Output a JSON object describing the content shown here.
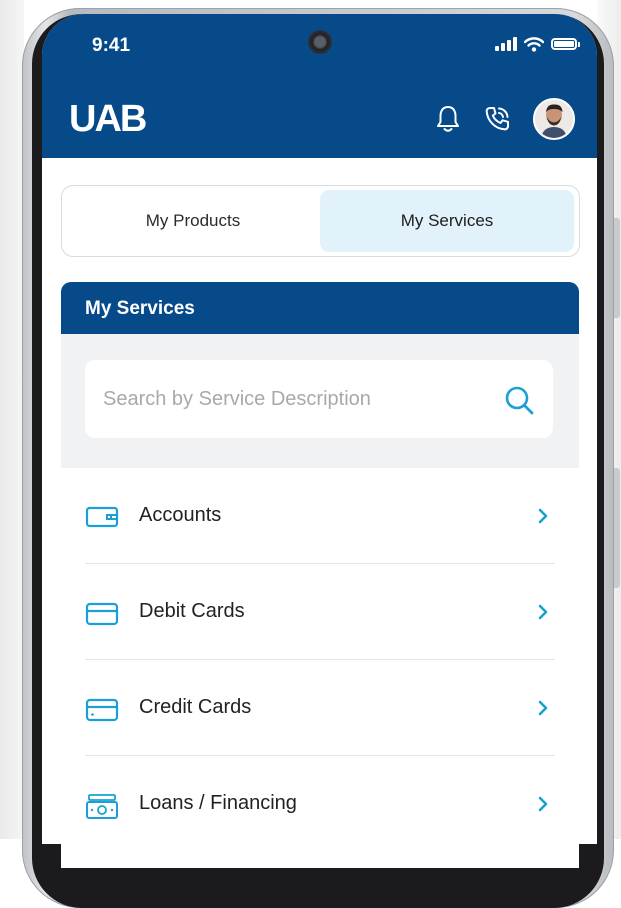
{
  "status_bar": {
    "time": "9:41"
  },
  "header": {
    "logo": "UAB"
  },
  "tabs": [
    {
      "label": "My Products",
      "selected": false
    },
    {
      "label": "My Services",
      "selected": true
    }
  ],
  "panel": {
    "title": "My Services",
    "search": {
      "placeholder": "Search by Service Description",
      "value": ""
    }
  },
  "services": [
    {
      "label": "Accounts",
      "icon": "wallet-icon"
    },
    {
      "label": "Debit Cards",
      "icon": "card-icon"
    },
    {
      "label": "Credit Cards",
      "icon": "card-icon"
    },
    {
      "label": "Loans / Financing",
      "icon": "cash-icon"
    }
  ],
  "colors": {
    "brand": "#064a8a",
    "accent": "#1aa0d6",
    "selected_tab": "#e2f2fb"
  }
}
